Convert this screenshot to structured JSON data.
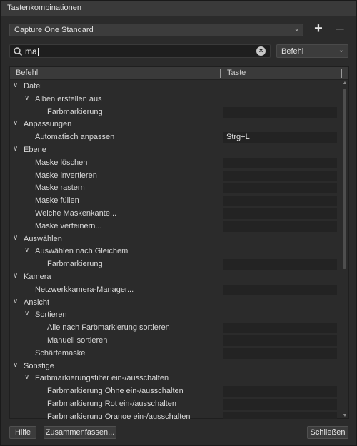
{
  "window": {
    "title": "Tastenkombinationen"
  },
  "preset": {
    "value": "Capture One Standard"
  },
  "search": {
    "value": "ma"
  },
  "filter": {
    "value": "Befehl"
  },
  "table": {
    "col_command": "Befehl",
    "col_key": "Taste",
    "rows": [
      {
        "label": "Datei",
        "level": 0,
        "expandable": true,
        "key": null
      },
      {
        "label": "Alben erstellen aus",
        "level": 1,
        "expandable": true,
        "key": null
      },
      {
        "label": "Farbmarkierung",
        "level": 2,
        "expandable": false,
        "key": ""
      },
      {
        "label": "Anpassungen",
        "level": 0,
        "expandable": true,
        "key": null
      },
      {
        "label": "Automatisch anpassen",
        "level": 1,
        "expandable": false,
        "key": "Strg+L"
      },
      {
        "label": "Ebene",
        "level": 0,
        "expandable": true,
        "key": null
      },
      {
        "label": "Maske löschen",
        "level": 1,
        "expandable": false,
        "key": ""
      },
      {
        "label": "Maske invertieren",
        "level": 1,
        "expandable": false,
        "key": ""
      },
      {
        "label": "Maske rastern",
        "level": 1,
        "expandable": false,
        "key": ""
      },
      {
        "label": "Maske füllen",
        "level": 1,
        "expandable": false,
        "key": ""
      },
      {
        "label": "Weiche Maskenkante...",
        "level": 1,
        "expandable": false,
        "key": ""
      },
      {
        "label": "Maske verfeinern...",
        "level": 1,
        "expandable": false,
        "key": ""
      },
      {
        "label": "Auswählen",
        "level": 0,
        "expandable": true,
        "key": null
      },
      {
        "label": "Auswählen nach Gleichem",
        "level": 1,
        "expandable": true,
        "key": null
      },
      {
        "label": "Farbmarkierung",
        "level": 2,
        "expandable": false,
        "key": ""
      },
      {
        "label": "Kamera",
        "level": 0,
        "expandable": true,
        "key": null
      },
      {
        "label": "Netzwerkkamera-Manager...",
        "level": 1,
        "expandable": false,
        "key": ""
      },
      {
        "label": "Ansicht",
        "level": 0,
        "expandable": true,
        "key": null
      },
      {
        "label": "Sortieren",
        "level": 1,
        "expandable": true,
        "key": null
      },
      {
        "label": "Alle nach Farbmarkierung sortieren",
        "level": 2,
        "expandable": false,
        "key": ""
      },
      {
        "label": "Manuell sortieren",
        "level": 2,
        "expandable": false,
        "key": ""
      },
      {
        "label": "Schärfemaske",
        "level": 1,
        "expandable": false,
        "key": ""
      },
      {
        "label": "Sonstige",
        "level": 0,
        "expandable": true,
        "key": null
      },
      {
        "label": "Farbmarkierungsfilter ein-/ausschalten",
        "level": 1,
        "expandable": true,
        "key": null
      },
      {
        "label": "Farbmarkierung Ohne ein-/ausschalten",
        "level": 2,
        "expandable": false,
        "key": ""
      },
      {
        "label": "Farbmarkierung Rot ein-/ausschalten",
        "level": 2,
        "expandable": false,
        "key": ""
      },
      {
        "label": "Farbmarkierung Orange ein-/ausschalten",
        "level": 2,
        "expandable": false,
        "key": ""
      }
    ]
  },
  "buttons": {
    "help": "Hilfe",
    "summarize": "Zusammenfassen...",
    "close": "Schließen"
  }
}
